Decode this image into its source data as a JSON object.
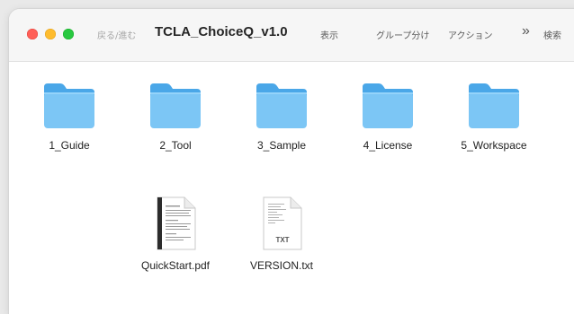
{
  "window": {
    "nav_label": "戻る/進む",
    "title": "TCLA_ChoiceQ_v1.0",
    "toolbar": {
      "view": "表示",
      "group": "グループ分け",
      "action": "アクション",
      "overflow": "»",
      "search": "検索"
    }
  },
  "items": [
    {
      "label": "1_Guide",
      "icon": "folder-icon"
    },
    {
      "label": "2_Tool",
      "icon": "folder-icon"
    },
    {
      "label": "3_Sample",
      "icon": "folder-icon"
    },
    {
      "label": "4_License",
      "icon": "folder-icon"
    },
    {
      "label": "5_Workspace",
      "icon": "folder-icon"
    },
    {
      "label": "QuickStart.pdf",
      "icon": "pdf-document-icon"
    },
    {
      "label": "VERSION.txt",
      "icon": "text-document-icon",
      "badge": "TXT"
    }
  ],
  "colors": {
    "folder_body": "#7cc6f5",
    "folder_tab": "#4aa7e8",
    "close": "#ff5f57",
    "minimize": "#febc2e",
    "zoom": "#28c840"
  }
}
